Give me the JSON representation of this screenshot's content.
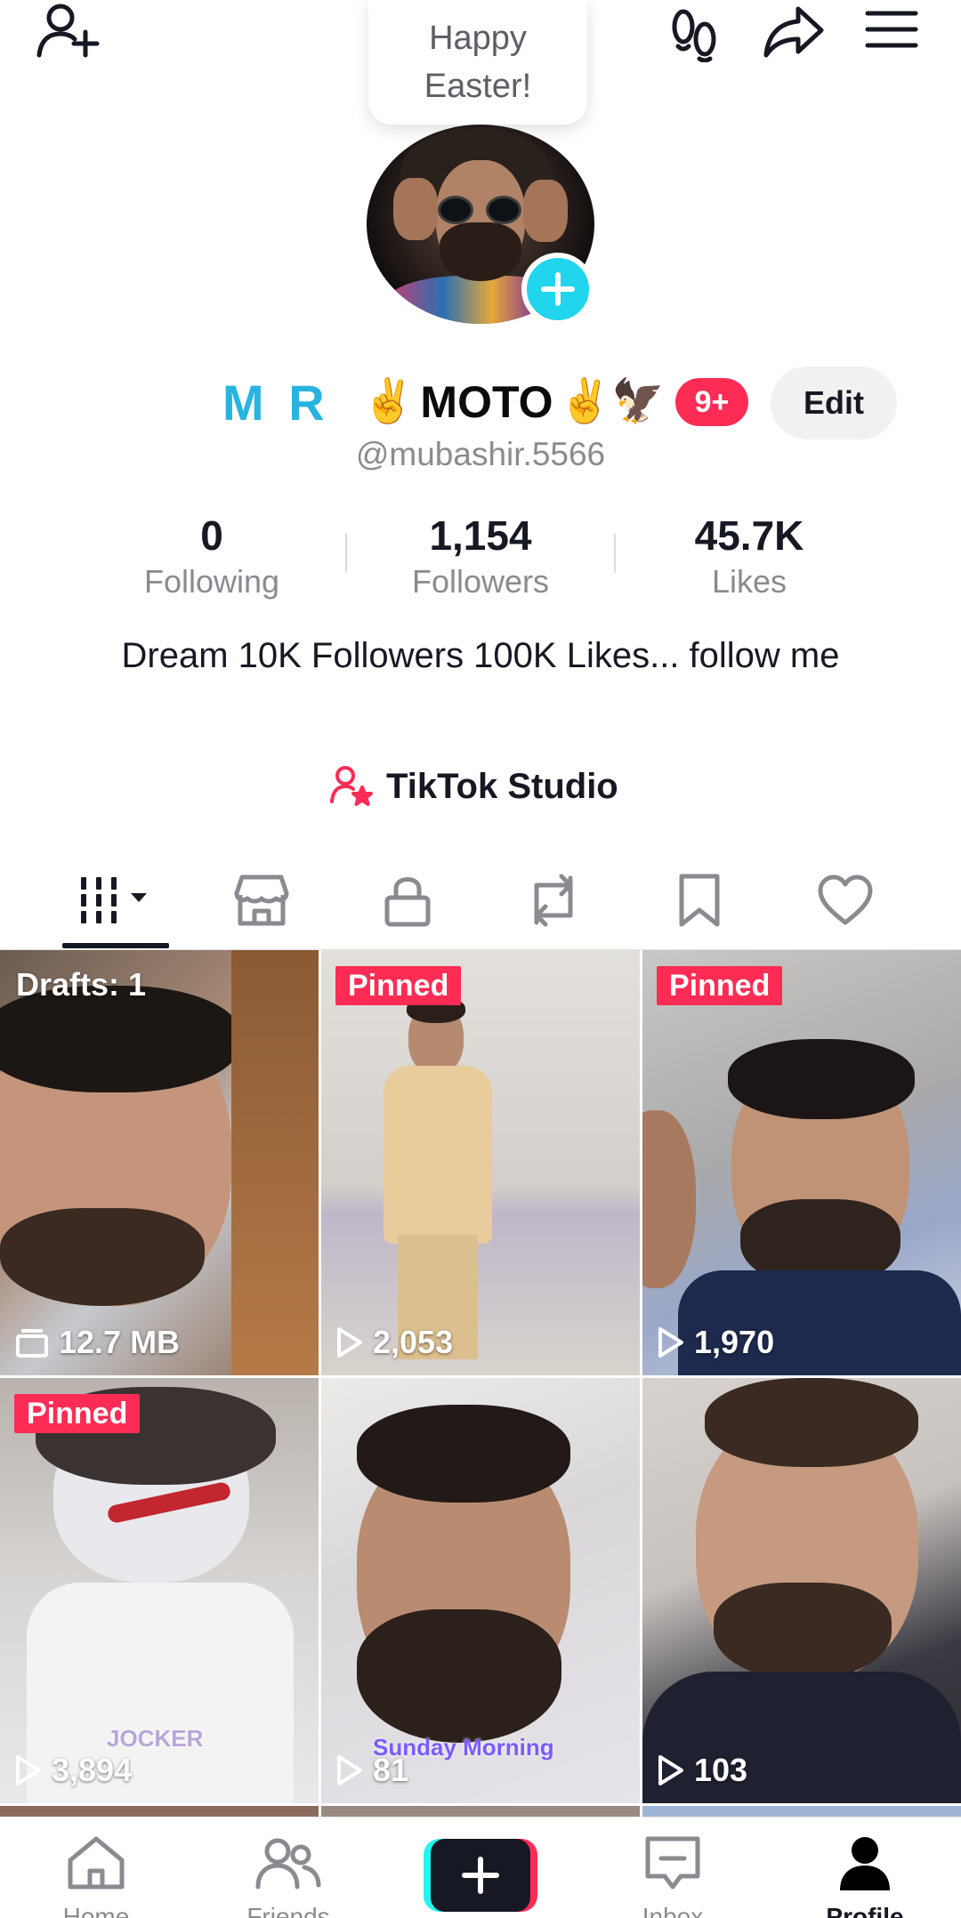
{
  "top_bar": {
    "icons": [
      "add-user-icon",
      "footprints-icon",
      "share-icon",
      "menu-icon"
    ],
    "bubble_line1": "Happy",
    "bubble_line2": "Easter!"
  },
  "profile": {
    "name_prefix": "M R",
    "name_emoji_left": "✌️",
    "name_main": "MOTO",
    "name_emoji_right": "✌️",
    "name_emoji_eagle": "🦅",
    "notification_badge": "9+",
    "edit_label": "Edit",
    "handle": "@mubashir.5566",
    "bio": "Dream 10K Followers 100K Likes... follow me",
    "studio_label": "TikTok Studio"
  },
  "stats": {
    "following_count": "0",
    "following_label": "Following",
    "followers_count": "1,154",
    "followers_label": "Followers",
    "likes_count": "45.7K",
    "likes_label": "Likes"
  },
  "tabs": {
    "items": [
      "videos-grid-icon",
      "shop-icon",
      "lock-icon",
      "repost-icon",
      "bookmark-icon",
      "heart-icon"
    ],
    "active": "videos-grid-icon"
  },
  "videos": [
    {
      "badge": "Drafts: 1",
      "stat": "12.7 MB",
      "stat_icon": "drafts-box-icon"
    },
    {
      "badge": "Pinned",
      "stat": "2,053",
      "stat_icon": "play-icon"
    },
    {
      "badge": "Pinned",
      "stat": "1,970",
      "stat_icon": "play-icon"
    },
    {
      "badge": "Pinned",
      "stat": "3,894",
      "stat_icon": "play-icon",
      "overlay": "JOCKER"
    },
    {
      "badge": "",
      "stat": "81",
      "stat_icon": "play-icon",
      "overlay": "Sunday Morning"
    },
    {
      "badge": "",
      "stat": "103",
      "stat_icon": "play-icon"
    }
  ],
  "bottom_nav": {
    "home_label": "Home",
    "friends_label": "Friends",
    "inbox_label": "Inbox",
    "profile_label": "Profile",
    "active": "Profile"
  },
  "colors": {
    "accent_red": "#fe2c55",
    "accent_cyan": "#25f4ee",
    "avatar_plus": "#20d5ec",
    "name_blue": "#28b3e1",
    "text_primary": "#161823",
    "text_secondary": "#8a8b91"
  }
}
